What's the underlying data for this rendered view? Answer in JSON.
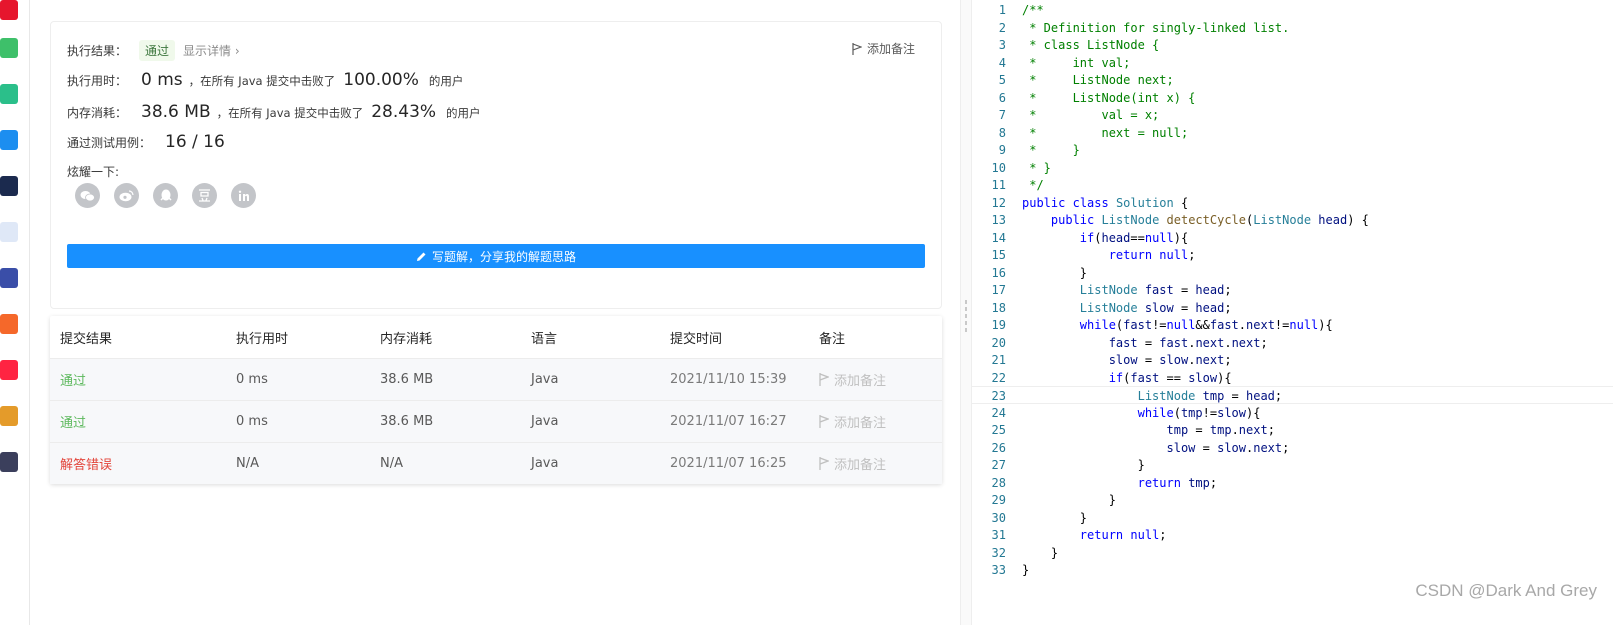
{
  "result": {
    "exec_result_label": "执行结果：",
    "status_badge": "通过",
    "details_link": "显示详情 ›",
    "add_note": "添加备注",
    "runtime_label": "执行用时：",
    "runtime_value": "0 ms",
    "runtime_beat_text": "，在所有 Java 提交中击败了",
    "runtime_percent": "100.00%",
    "users_suffix": "的用户",
    "memory_label": "内存消耗：",
    "memory_value": "38.6 MB",
    "memory_beat_text": "，在所有 Java 提交中击败了",
    "memory_percent": "28.43%",
    "cases_label": "通过测试用例：",
    "cases_value": "16 / 16",
    "share_label": "炫耀一下:",
    "share_icons": [
      "wechat-icon",
      "weibo-icon",
      "qq-icon",
      "douban-icon",
      "linkedin-icon"
    ],
    "write_solution": "写题解，分享我的解题思路"
  },
  "table": {
    "headers": [
      "提交结果",
      "执行用时",
      "内存消耗",
      "语言",
      "提交时间",
      "备注"
    ],
    "rows": [
      {
        "status": "通过",
        "runtime": "0 ms",
        "memory": "38.6 MB",
        "language": "Java",
        "time": "2021/11/10 15:39",
        "note": "添加备注"
      },
      {
        "status": "通过",
        "runtime": "0 ms",
        "memory": "38.6 MB",
        "language": "Java",
        "time": "2021/11/07 16:27",
        "note": "添加备注"
      },
      {
        "status": "解答错误",
        "runtime": "N/A",
        "memory": "N/A",
        "language": "Java",
        "time": "2021/11/07 16:25",
        "note": "添加备注"
      }
    ]
  },
  "colors": {
    "primary": "#1890ff",
    "accepted": "#5cb85c",
    "wrong": "#e3453b"
  },
  "code": {
    "lines": [
      "/**",
      " * Definition for singly-linked list.",
      " * class ListNode {",
      " *     int val;",
      " *     ListNode next;",
      " *     ListNode(int x) {",
      " *         val = x;",
      " *         next = null;",
      " *     }",
      " * }",
      " */",
      "public class Solution {",
      "    public ListNode detectCycle(ListNode head) {",
      "        if(head==null){",
      "            return null;",
      "        }",
      "        ListNode fast = head;",
      "        ListNode slow = head;",
      "        while(fast!=null&&fast.next!=null){",
      "            fast = fast.next.next;",
      "            slow = slow.next;",
      "            if(fast == slow){",
      "                ListNode tmp = head;",
      "                while(tmp!=slow){",
      "                    tmp = tmp.next;",
      "                    slow = slow.next;",
      "                }",
      "                return tmp;",
      "            }",
      "        }",
      "        return null;",
      "    }",
      "}"
    ],
    "current_line": 23
  },
  "watermark": "CSDN @Dark And Grey"
}
